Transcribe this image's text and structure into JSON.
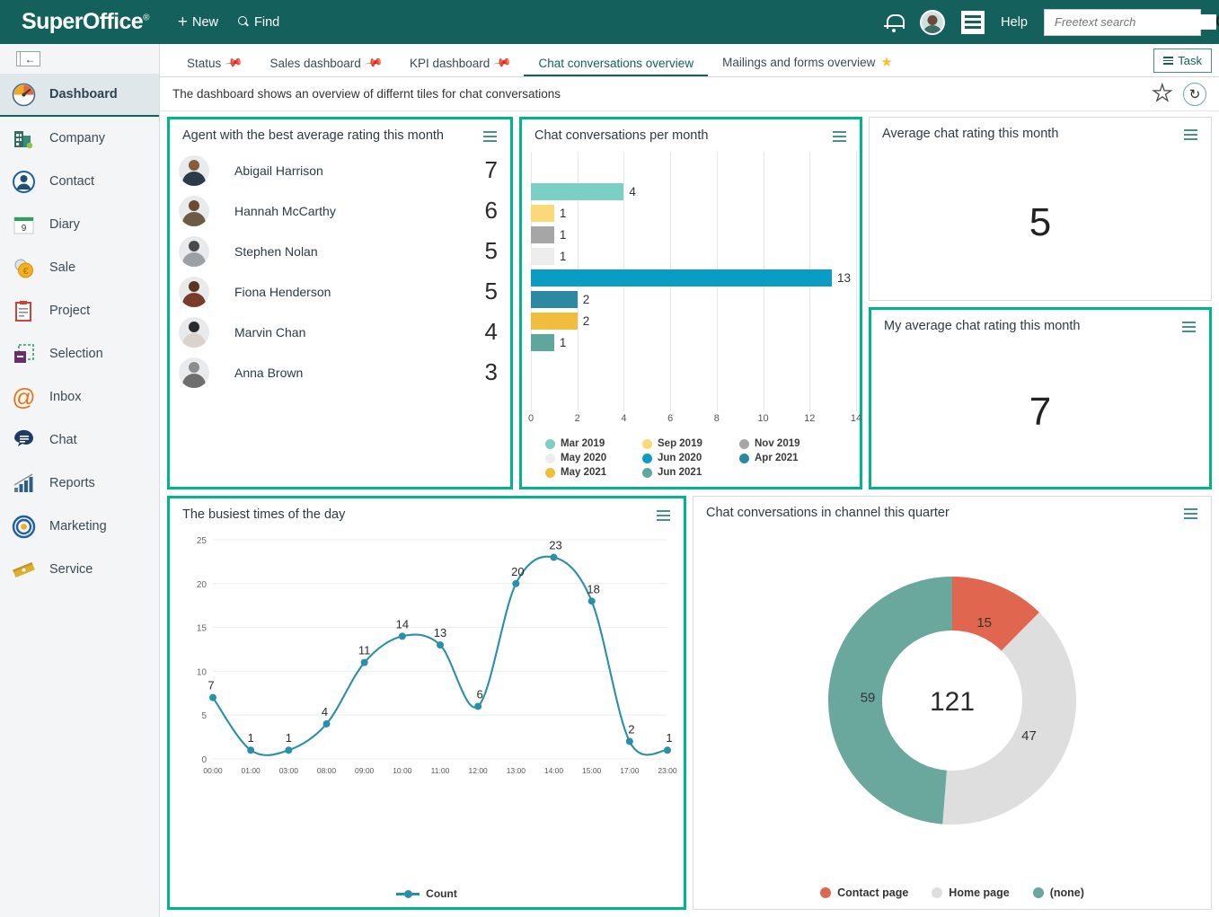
{
  "app": {
    "brand": "SuperOffice",
    "brand_mark": "®",
    "accent": "#14605c",
    "selected_tile_border": "#00b48c"
  },
  "topnav": {
    "new_label": "New",
    "find_label": "Find",
    "help_label": "Help",
    "search": {
      "placeholder": "Freetext search",
      "value": ""
    }
  },
  "sidebar": {
    "collapse_glyph": "←",
    "items": [
      {
        "label": "Dashboard",
        "icon": "gauge-icon",
        "active": true
      },
      {
        "label": "Company",
        "icon": "building-icon",
        "active": false
      },
      {
        "label": "Contact",
        "icon": "person-icon",
        "active": false
      },
      {
        "label": "Diary",
        "icon": "calendar-icon",
        "active": false,
        "badge": "9"
      },
      {
        "label": "Sale",
        "icon": "coin-icon",
        "active": false
      },
      {
        "label": "Project",
        "icon": "clipboard-icon",
        "active": false
      },
      {
        "label": "Selection",
        "icon": "selection-icon",
        "active": false
      },
      {
        "label": "Inbox",
        "icon": "at-icon",
        "active": false
      },
      {
        "label": "Chat",
        "icon": "speech-bubble-icon",
        "active": false
      },
      {
        "label": "Reports",
        "icon": "bar-chart-icon",
        "active": false
      },
      {
        "label": "Marketing",
        "icon": "target-icon",
        "active": false
      },
      {
        "label": "Service",
        "icon": "ticket-icon",
        "active": false
      }
    ]
  },
  "tabs": [
    {
      "label": "Status",
      "pinned": true,
      "starred": false,
      "active": false
    },
    {
      "label": "Sales dashboard",
      "pinned": true,
      "starred": false,
      "active": false
    },
    {
      "label": "KPI dashboard",
      "pinned": true,
      "starred": false,
      "active": false
    },
    {
      "label": "Chat conversations overview",
      "pinned": false,
      "starred": false,
      "active": true
    },
    {
      "label": "Mailings and forms overview",
      "pinned": false,
      "starred": true,
      "active": false
    }
  ],
  "task_button": {
    "label": "Task"
  },
  "description": "The dashboard shows an overview of differnt tiles for chat conversations",
  "tiles": {
    "agents": {
      "title": "Agent with the best average rating this month",
      "rows": [
        {
          "name": "Abigail Harrison",
          "value": "7"
        },
        {
          "name": "Hannah McCarthy",
          "value": "6"
        },
        {
          "name": "Stephen Nolan",
          "value": "5"
        },
        {
          "name": "Fiona Henderson",
          "value": "5"
        },
        {
          "name": "Marvin Chan",
          "value": "4"
        },
        {
          "name": "Anna Brown",
          "value": "3"
        }
      ]
    },
    "per_month": {
      "title": "Chat conversations per month"
    },
    "avg_rating": {
      "title": "Average chat rating this month",
      "value": "5"
    },
    "my_avg_rating": {
      "title": "My average chat rating this month",
      "value": "7"
    },
    "busiest": {
      "title": "The busiest times of the day"
    },
    "channel": {
      "title": "Chat conversations in channel this quarter"
    }
  },
  "chart_data": [
    {
      "id": "chat_conversations_per_month",
      "type": "bar",
      "orientation": "horizontal",
      "title": "Chat conversations per month",
      "categories": [
        "Mar 2019",
        "Sep 2019",
        "Nov 2019",
        "May 2020",
        "Jun 2020",
        "Apr 2021",
        "May 2021",
        "Jun 2021"
      ],
      "values": [
        4,
        1,
        1,
        1,
        13,
        2,
        2,
        1
      ],
      "colors": [
        "#7ccfc4",
        "#fcd978",
        "#a6a6a6",
        "#ededed",
        "#0b9cc4",
        "#2d88a2",
        "#f0bd3d",
        "#5fa69c"
      ],
      "xlabel": "",
      "ylabel": "",
      "xlim": [
        0,
        14
      ],
      "xticks": [
        0,
        2,
        4,
        6,
        8,
        10,
        12,
        14
      ],
      "grid": true,
      "legend_position": "bottom",
      "legend_columns": 3
    },
    {
      "id": "busiest_times_of_day",
      "type": "line",
      "title": "The busiest times of the day",
      "categories": [
        "00:00",
        "01:00",
        "03:00",
        "08:00",
        "09:00",
        "10:00",
        "11:00",
        "12:00",
        "13:00",
        "14:00",
        "15:00",
        "17:00",
        "23:00"
      ],
      "series": [
        {
          "name": "Count",
          "values": [
            7,
            1,
            1,
            4,
            11,
            14,
            13,
            6,
            20,
            23,
            18,
            2,
            1
          ],
          "color": "#2a8fa8"
        }
      ],
      "ylim": [
        0,
        25
      ],
      "yticks": [
        0,
        5,
        10,
        15,
        20,
        25
      ],
      "xlabel": "",
      "ylabel": "",
      "grid": true,
      "legend_position": "bottom",
      "smooth": true,
      "data_labels": true
    },
    {
      "id": "chat_conversations_in_channel_this_quarter",
      "type": "pie",
      "variant": "donut",
      "title": "Chat conversations in channel this quarter",
      "labels": [
        "Contact page",
        "Home page",
        "(none)"
      ],
      "values": [
        15,
        47,
        59
      ],
      "colors": [
        "#e1664f",
        "#dedede",
        "#6aa79d"
      ],
      "center_label": "121",
      "total": 121,
      "legend_position": "bottom"
    }
  ]
}
